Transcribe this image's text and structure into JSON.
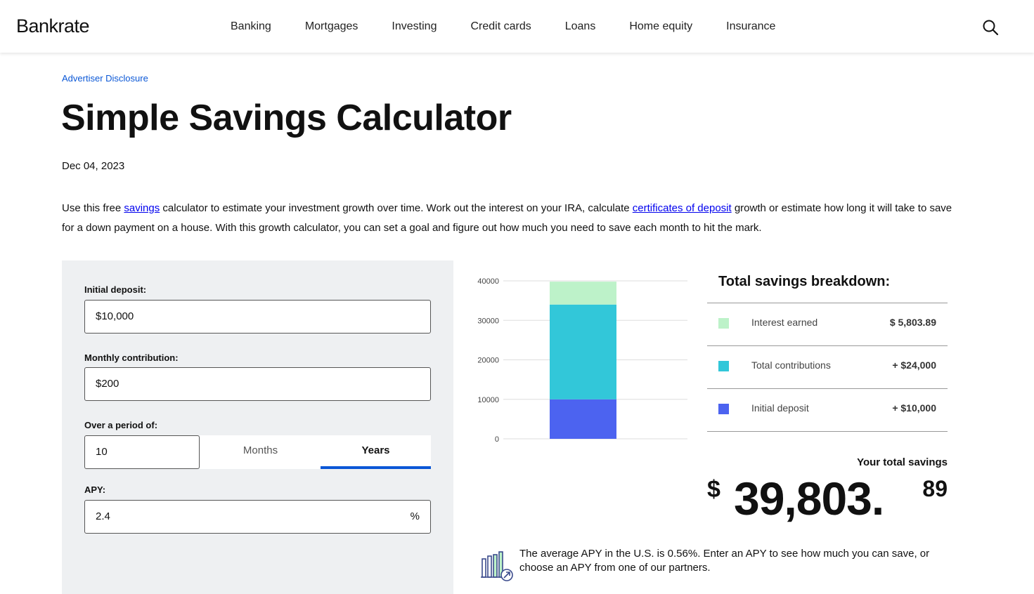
{
  "header": {
    "logo": "Bankrate",
    "nav": [
      "Banking",
      "Mortgages",
      "Investing",
      "Credit cards",
      "Loans",
      "Home equity",
      "Insurance"
    ],
    "search_icon": "search-icon"
  },
  "page": {
    "disclosure": "Advertiser Disclosure",
    "title": "Simple Savings Calculator",
    "date": "Dec 04, 2023",
    "intro": {
      "p1": "Use this free ",
      "link1": "savings",
      "p2": " calculator to estimate your investment growth over time. Work out the interest on your IRA, calculate ",
      "link2": "certificates of deposit",
      "p3": " growth or estimate how long it will take to save for a down payment on a house. With this growth calculator, you can set a goal and figure out how much you need to save each month to hit the mark."
    }
  },
  "form": {
    "initial_label": "Initial deposit:",
    "initial_value": "$10,000",
    "monthly_label": "Monthly contribution:",
    "monthly_value": "$200",
    "period_label": "Over a period of:",
    "period_value": "10",
    "unit_months": "Months",
    "unit_years": "Years",
    "selected_unit": "Years",
    "apy_label": "APY:",
    "apy_value": "2.4",
    "apy_suffix": "%"
  },
  "chart_data": {
    "type": "bar",
    "stacked": true,
    "ylim": [
      0,
      40000
    ],
    "yticks": [
      "40000",
      "30000",
      "20000",
      "10000",
      "0"
    ],
    "series": [
      {
        "name": "Initial deposit",
        "values": [
          10000
        ],
        "color": "#4c63f0"
      },
      {
        "name": "Total contributions",
        "values": [
          24000
        ],
        "color": "#32c7d9"
      },
      {
        "name": "Interest earned",
        "values": [
          5803.89
        ],
        "color": "#bdf2c9"
      }
    ],
    "grid": true
  },
  "breakdown": {
    "title": "Total savings breakdown:",
    "rows": [
      {
        "label": "Interest earned",
        "value": "$ 5,803.89",
        "color": "#bdf2c9"
      },
      {
        "label": "Total contributions",
        "value": "+ $24,000",
        "color": "#32c7d9"
      },
      {
        "label": "Initial deposit",
        "value": "+ $10,000",
        "color": "#4c63f0"
      }
    ],
    "total_label": "Your total savings",
    "currency": "$",
    "total_whole": "39,803.",
    "total_cents": "89"
  },
  "note": {
    "icon": "bar-chart-icon",
    "text": "The average APY in the U.S. is 0.56%. Enter an APY to see how much you can save, or choose an APY from one of our partners."
  }
}
